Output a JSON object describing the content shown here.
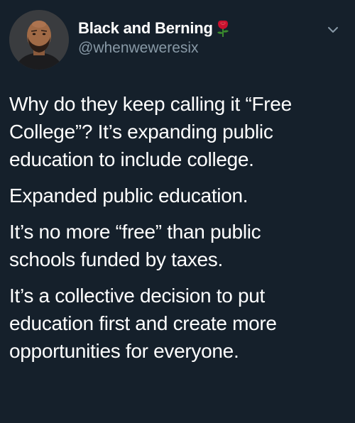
{
  "author": {
    "display_name": "Black and Berning",
    "name_emoji": "rose-icon",
    "handle": "@whenweweresix",
    "avatar": "profile-photo"
  },
  "menu": {
    "icon": "chevron-down-icon"
  },
  "tweet": {
    "paragraphs": [
      "Why do they keep calling it “Free\nCollege”? It’s expanding public\neducation to include college.",
      "Expanded public education.",
      "It’s no more “free” than public\nschools funded by taxes.",
      "It’s a collective decision to put\neducation first and create more\nopportunities for everyone."
    ]
  },
  "colors": {
    "background": "#15202b",
    "text_primary": "#ffffff",
    "text_secondary": "#8899a6",
    "rose": "#c8102e"
  }
}
